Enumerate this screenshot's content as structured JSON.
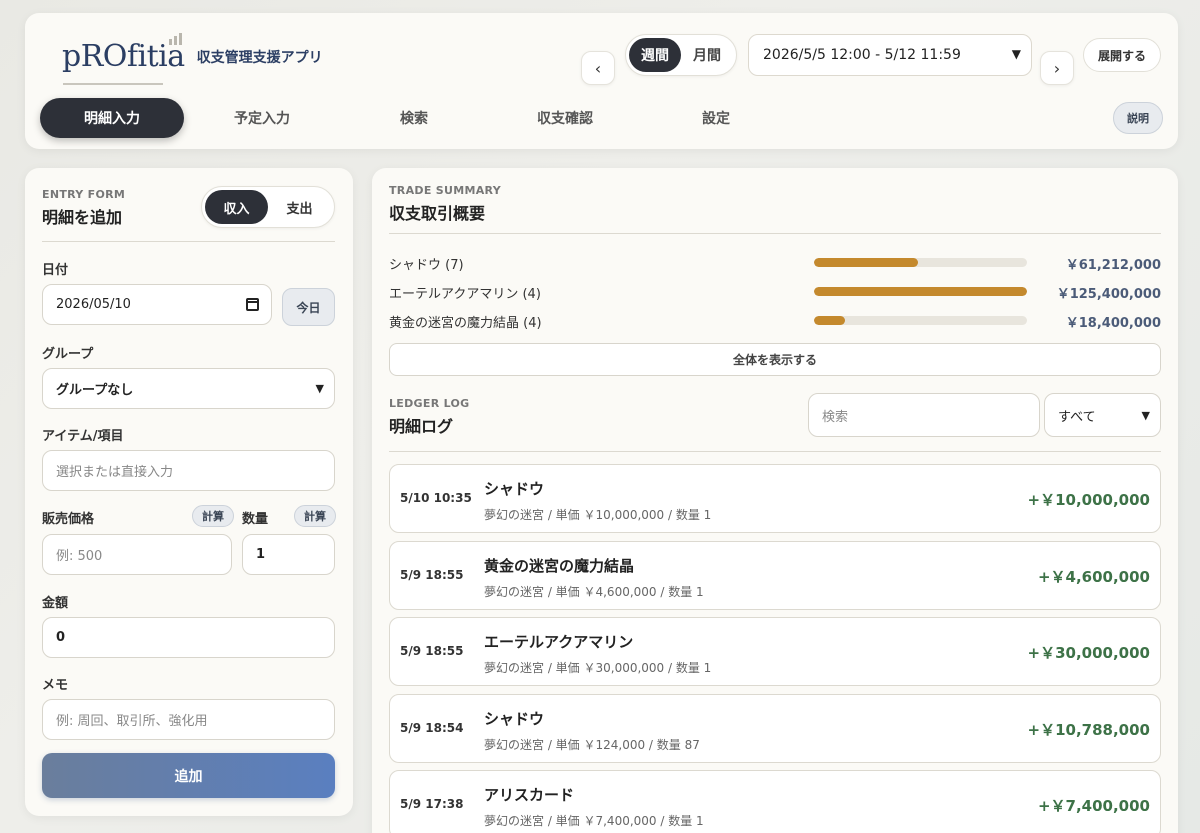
{
  "header": {
    "logo_word": "pROfitia",
    "logo_subtitle": "収支管理支援アプリ",
    "prev_label": "‹",
    "next_label": "›",
    "period_tabs": [
      "週間",
      "月間"
    ],
    "range": "2026/5/5 12:00 - 5/12 11:59",
    "expand_label": "展開する",
    "help_label": "説明",
    "tabs": [
      "明細入力",
      "予定入力",
      "検索",
      "収支確認",
      "設定"
    ],
    "active_tab": "明細入力"
  },
  "entry_form": {
    "eyebrow": "ENTRY FORM",
    "title": "明細を追加",
    "type_options": [
      "収入",
      "支出"
    ],
    "date_label": "日付",
    "date_value": "2026/05/10",
    "today_label": "今日",
    "group_label": "グループ",
    "group_value": "グループなし",
    "item_label": "アイテム/項目",
    "item_placeholder": "選択または直接入力",
    "price_label": "販売価格",
    "price_calc": "計算",
    "price_placeholder": "例: 500",
    "qty_label": "数量",
    "qty_calc": "計算",
    "qty_value": "1",
    "amount_label": "金額",
    "amount_value": "0",
    "memo_label": "メモ",
    "memo_placeholder": "例: 周回、取引所、強化用",
    "add_label": "追加"
  },
  "trade_summary": {
    "eyebrow": "TRADE SUMMARY",
    "title": "収支取引概要",
    "rows": [
      {
        "name": "シャドウ (7)",
        "amount": "￥61,212,000",
        "ratio": 0.488
      },
      {
        "name": "エーテルアクアマリン (4)",
        "amount": "￥125,400,000",
        "ratio": 1.0
      },
      {
        "name": "黄金の迷宮の魔力結晶 (4)",
        "amount": "￥18,400,000",
        "ratio": 0.147
      }
    ],
    "show_all_label": "全体を表示する"
  },
  "ledger": {
    "eyebrow": "LEDGER LOG",
    "title": "明細ログ",
    "search_placeholder": "検索",
    "filter_value": "すべて",
    "items": [
      {
        "time": "5/10 10:35",
        "name": "シャドウ",
        "detail": "夢幻の迷宮 / 単価 ￥10,000,000 / 数量 1",
        "amount": "+￥10,000,000"
      },
      {
        "time": "5/9 18:55",
        "name": "黄金の迷宮の魔力結晶",
        "detail": "夢幻の迷宮 / 単価 ￥4,600,000 / 数量 1",
        "amount": "+￥4,600,000"
      },
      {
        "time": "5/9 18:55",
        "name": "エーテルアクアマリン",
        "detail": "夢幻の迷宮 / 単価 ￥30,000,000 / 数量 1",
        "amount": "+￥30,000,000"
      },
      {
        "time": "5/9 18:54",
        "name": "シャドウ",
        "detail": "夢幻の迷宮 / 単価 ￥124,000 / 数量 87",
        "amount": "+￥10,788,000"
      },
      {
        "time": "5/9 17:38",
        "name": "アリスカード",
        "detail": "夢幻の迷宮 / 単価 ￥7,400,000 / 数量 1",
        "amount": "+￥7,400,000"
      }
    ]
  },
  "colors": {
    "accent_dark": "#2d3038",
    "bar_fill": "#c4892d",
    "income_green": "#3d7247",
    "brand_navy": "#2b3e63"
  }
}
